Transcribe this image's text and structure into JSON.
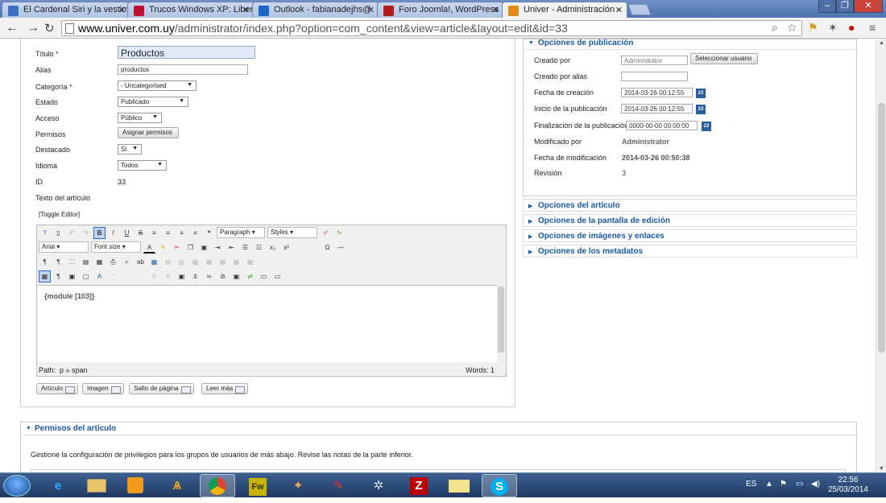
{
  "browser": {
    "tabs": [
      {
        "title": "El Cardenal Siri y la vestim",
        "icon_color": "#3a6fc4"
      },
      {
        "title": "Trucos Windows XP: Liber",
        "icon_color": "#c0102f"
      },
      {
        "title": "Outlook - fabianadejhs@",
        "icon_color": "#1c66c9"
      },
      {
        "title": "Foro Joomla!, WordPress",
        "icon_color": "#b21c1c"
      },
      {
        "title": "Univer - Administración -",
        "icon_color": "#e08a1a"
      }
    ],
    "url_host": "www.univer.com.uy",
    "url_path": "/administrator/index.php?option=com_content&view=article&layout=edit&id=33"
  },
  "form": {
    "titulo_label": "Título",
    "titulo_value": "Productos",
    "alias_label": "Alias",
    "alias_value": "productos",
    "categoria_label": "Categoría",
    "categoria_value": "- Uncategorised",
    "estado_label": "Estado",
    "estado_value": "Publicado",
    "acceso_label": "Acceso",
    "acceso_value": "Público",
    "permisos_label": "Permisos",
    "permisos_button": "Asignar permisos",
    "destacado_label": "Destacado",
    "destacado_value": "Sí",
    "idioma_label": "Idioma",
    "idioma_value": "Todos",
    "id_label": "ID",
    "id_value": "33",
    "texto_label": "Texto del artículo",
    "toggle_editor": "[Toggle Editor]"
  },
  "editor": {
    "format_select": "Paragraph",
    "styles_select": "Styles",
    "font_select": "Arial",
    "size_select": "Font size",
    "content": "{module [103]}",
    "path_label": "Path:",
    "path_value": "p » span",
    "words": "Words: 1",
    "buttons": [
      "Artículo",
      "Imagen",
      "Salto de página",
      "Leer más"
    ]
  },
  "publishing": {
    "header": "Opciones de publicación",
    "creado_por_label": "Creado por",
    "creado_por_value": "Administrator",
    "select_user_button": "Seleccionar usuario",
    "creado_alias_label": "Creado por alias",
    "fecha_creacion_label": "Fecha de creación",
    "fecha_creacion_value": "2014-03-26 00:12:55",
    "inicio_label": "Inicio de la publicación",
    "inicio_value": "2014-03-26 00:12:55",
    "fin_label": "Finalización de la publicación",
    "fin_value": "0000-00-00 00:00:00",
    "modificado_label": "Modificado por",
    "modificado_value": "Administrator",
    "fecha_mod_label": "Fecha de modificación",
    "fecha_mod_value": "2014-03-26 00:50:38",
    "revision_label": "Revisión",
    "revision_value": "3",
    "calendar_icon_text": "23"
  },
  "accordions": [
    "Opciones del artículo",
    "Opciones de la pantalla de edición",
    "Opciones de imágenes y enlaces",
    "Opciones de los metadatos"
  ],
  "permissions": {
    "header": "Permisos del artículo",
    "text": "Gestione la configuración de privilegios para los grupos de usuarios de más abajo. Revise las notas de la parte inferior."
  },
  "taskbar": {
    "lang": "ES",
    "time": "22:56",
    "date": "25/03/2014",
    "apps": [
      "ie-icon",
      "explorer-icon",
      "media-player-icon",
      "avast-icon",
      "chrome-icon",
      "fireworks-icon",
      "game-icon",
      "pen-icon",
      "tool-icon",
      "filezilla-icon",
      "folder-icon",
      "skype-icon"
    ],
    "app_labels": [
      "e",
      "",
      "",
      "",
      "",
      "Fw",
      "",
      "",
      "",
      "Z",
      "",
      "S"
    ]
  }
}
